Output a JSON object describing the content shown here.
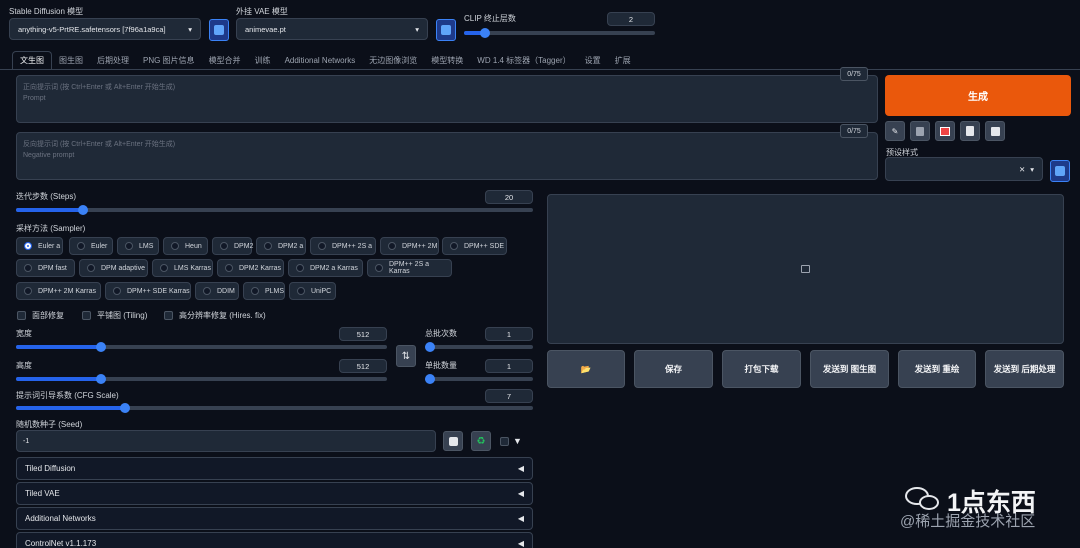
{
  "top": {
    "sd_model_label": "Stable Diffusion 模型",
    "sd_model_value": "anything-v5-PrtRE.safetensors [7f96a1a9ca]",
    "vae_label": "外挂 VAE 模型",
    "vae_value": "animevae.pt",
    "clip_label": "CLIP 终止层数",
    "clip_value": "2"
  },
  "tabs": [
    "文生图",
    "图生图",
    "后期处理",
    "PNG 图片信息",
    "模型合并",
    "训练",
    "Additional Networks",
    "无边图像浏览",
    "模型转换",
    "WD 1.4 标签器（Tagger）",
    "设置",
    "扩展"
  ],
  "prompt": {
    "pos_placeholder_1": "正向提示词 (按 Ctrl+Enter 或 Alt+Enter 开始生成)",
    "pos_placeholder_2": "Prompt",
    "pos_counter": "0/75",
    "neg_placeholder_1": "反向提示词 (按 Ctrl+Enter 或 Alt+Enter 开始生成)",
    "neg_placeholder_2": "Negative prompt",
    "neg_counter": "0/75"
  },
  "generate_label": "生成",
  "styles_label": "预设样式",
  "steps": {
    "label": "迭代步数 (Steps)",
    "value": "20",
    "fraction": 0.13
  },
  "sampler": {
    "label": "采样方法 (Sampler)",
    "options": [
      "Euler a",
      "Euler",
      "LMS",
      "Heun",
      "DPM2",
      "DPM2 a",
      "DPM++ 2S a",
      "DPM++ 2M",
      "DPM++ SDE",
      "DPM fast",
      "DPM adaptive",
      "LMS Karras",
      "DPM2 Karras",
      "DPM2 a Karras",
      "DPM++ 2S a Karras",
      "DPM++ 2M Karras",
      "DPM++ SDE Karras",
      "DDIM",
      "PLMS",
      "UniPC"
    ],
    "selected": "Euler a"
  },
  "checks": {
    "restore_faces": "面部修复",
    "tiling": "平铺图 (Tiling)",
    "hires": "高分辨率修复 (Hires. fix)"
  },
  "width": {
    "label": "宽度",
    "value": "512",
    "fraction": 0.23
  },
  "height": {
    "label": "高度",
    "value": "512",
    "fraction": 0.23
  },
  "batch_count": {
    "label": "总批次数",
    "value": "1",
    "fraction": 0.0
  },
  "batch_size": {
    "label": "单批数量",
    "value": "1",
    "fraction": 0.0
  },
  "cfg": {
    "label": "提示词引导系数 (CFG Scale)",
    "value": "7",
    "fraction": 0.21
  },
  "seed": {
    "label": "随机数种子 (Seed)",
    "value": "-1"
  },
  "accordions": [
    "Tiled Diffusion",
    "Tiled VAE",
    "Additional Networks",
    "ControlNet v1.1.173"
  ],
  "actions": {
    "folder": "📂",
    "save": "保存",
    "zip": "打包下载",
    "to_img2img": "发送到 图生图",
    "to_inpaint": "发送到 重绘",
    "to_extras": "发送到 后期处理"
  },
  "watermark": {
    "brand": "1点东西",
    "site": "@稀土掘金技术社区"
  },
  "colors": {
    "generate": "#ea580c",
    "accent": "#2563eb"
  }
}
